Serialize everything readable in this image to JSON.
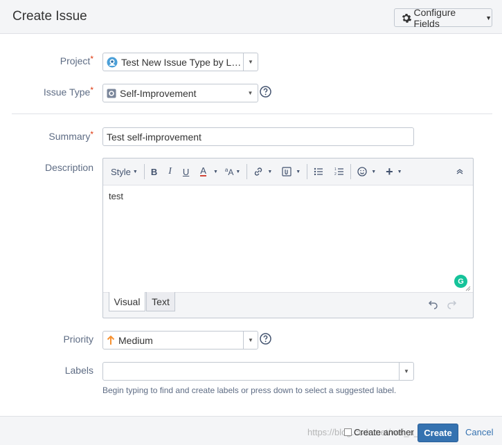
{
  "header": {
    "title": "Create Issue",
    "configure_label": "Configure Fields"
  },
  "project": {
    "label": "Project",
    "value": "Test New Issue Type by LEO…"
  },
  "issue_type": {
    "label": "Issue Type",
    "value": "Self-Improvement"
  },
  "summary": {
    "label": "Summary",
    "value": "Test self-improvement"
  },
  "description": {
    "label": "Description",
    "style_label": "Style",
    "content": "test",
    "tab_visual": "Visual",
    "tab_text": "Text"
  },
  "priority": {
    "label": "Priority",
    "value": "Medium",
    "accent_color": "#f79232"
  },
  "labels": {
    "label": "Labels",
    "value": "",
    "hint": "Begin typing to find and create labels or press down to select a suggested label."
  },
  "footer": {
    "create_another_label": "Create another",
    "create_label": "Create",
    "cancel_label": "Cancel",
    "watermark": "https://blog.csdn.net/wei_a__Lifeng"
  },
  "colors": {
    "primary": "#3572b0",
    "required": "#de350b",
    "grammarly": "#15c39a"
  },
  "icons": [
    "gear-icon",
    "project-avatar-icon",
    "issue-type-icon",
    "help-icon",
    "priority-medium-icon",
    "grammarly-icon",
    "undo-icon",
    "redo-icon"
  ]
}
